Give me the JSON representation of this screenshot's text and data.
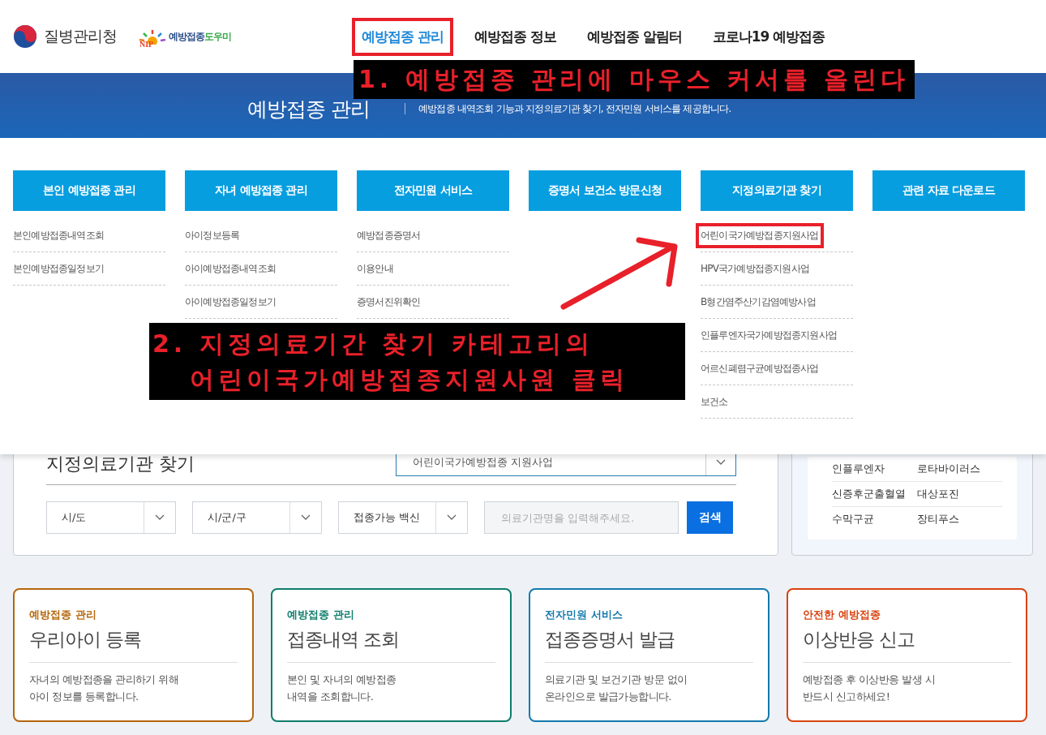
{
  "header": {
    "agency_name": "질병관리청",
    "site_logo": {
      "mark": "NIP",
      "name": "예방접종",
      "name_accent": "도우미"
    },
    "nav": [
      {
        "label": "예방접종 관리",
        "selected": true,
        "highlighted": true
      },
      {
        "label": "예방접종 정보",
        "selected": false,
        "highlighted": false
      },
      {
        "label": "예방접종 알림터",
        "selected": false,
        "highlighted": false
      },
      {
        "label": "코로나19 예방접종",
        "selected": false,
        "highlighted": false
      }
    ]
  },
  "banner": {
    "title": "예방접종 관리",
    "description": "예방접종 내역조회 기능과 지정의료기관 찾기, 전자민원 서비스를 제공합니다."
  },
  "mega_menu": [
    {
      "heading": "본인 예방접종 관리",
      "items": [
        {
          "label": "본인예방접종내역조회",
          "highlighted": false
        },
        {
          "label": "본인예방접종일정보기",
          "highlighted": false
        }
      ]
    },
    {
      "heading": "자녀 예방접종 관리",
      "items": [
        {
          "label": "아이정보등록",
          "highlighted": false
        },
        {
          "label": "아이예방접종내역조회",
          "highlighted": false
        },
        {
          "label": "아이예방접종일정보기",
          "highlighted": false
        }
      ]
    },
    {
      "heading": "전자민원 서비스",
      "items": [
        {
          "label": "예방접종증명서",
          "highlighted": false
        },
        {
          "label": "이용안내",
          "highlighted": false
        },
        {
          "label": "증명서진위확인",
          "highlighted": false
        }
      ]
    },
    {
      "heading": "증명서 보건소 방문신청"
    },
    {
      "heading": "지정의료기관 찾기",
      "items": [
        {
          "label": "어린이국가예방접종지원사업",
          "highlighted": true
        },
        {
          "label": "HPV국가예방접종지원사업",
          "highlighted": false
        },
        {
          "label": "B형간염주산기감염예방사업",
          "highlighted": false
        },
        {
          "label": "인플루엔자국가예방접종지원사업",
          "highlighted": false
        },
        {
          "label": "어르신폐렴구균예방접종사업",
          "highlighted": false
        },
        {
          "label": "보건소",
          "highlighted": false
        }
      ]
    },
    {
      "heading": "관련 자료 다운로드"
    }
  ],
  "search_panel": {
    "title": "지정의료기관 찾기",
    "program_select": "어린이국가예방접종 지원사업",
    "filters": [
      "시/도",
      "시/군/구",
      "접종가능 백신"
    ],
    "name_field": {
      "placeholder": "의료기관명을 입력해주세요."
    },
    "search_button": "검색"
  },
  "disease_panel": {
    "rows": [
      [
        "인플루엔자",
        "로타바이러스"
      ],
      [
        "신증후군출혈열",
        "대상포진"
      ],
      [
        "수막구균",
        "장티푸스"
      ]
    ]
  },
  "service_cards": [
    {
      "category": "예방접종 관리",
      "title": "우리아이 등록",
      "lines": [
        "자녀의 예방접종을 관리하기 위해",
        "아이 정보를 등록합니다."
      ],
      "color": "#b5660c"
    },
    {
      "category": "예방접종 관리",
      "title": "접종내역 조회",
      "lines": [
        "본인 및 자녀의 예방접종",
        "내역을 조회합니다."
      ],
      "color": "#0f7d6c"
    },
    {
      "category": "전자민원 서비스",
      "title": "접종증명서 발급",
      "lines": [
        "의료기관 및 보건기관 방문 없이",
        "온라인으로 발급가능합니다."
      ],
      "color": "#1479ad"
    },
    {
      "category": "안전한 예방접종",
      "title": "이상반응 신고",
      "lines": [
        "예방접종 후 이상반응 발생 시",
        "반드시 신고하세요!"
      ],
      "color": "#d9430f"
    }
  ],
  "annotations": [
    {
      "lines": [
        "1. 예방접종 관리에 마우스 커서를 올린다"
      ]
    },
    {
      "lines": [
        "2. 지정의료기간 찾기 카테고리의",
        "   어린이국가예방접종지원사원 클릭"
      ]
    }
  ]
}
